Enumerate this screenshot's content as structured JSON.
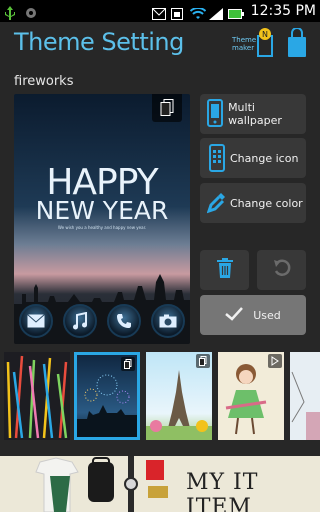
{
  "status_bar": {
    "time": "12:35 PM",
    "notification_badge": "N"
  },
  "header": {
    "title": "Theme Setting",
    "theme_maker_label": "Theme\nmaker",
    "accent_color": "#5cc0ea"
  },
  "theme_name": "fireworks",
  "preview": {
    "headline_1": "HAPPY",
    "headline_2": "NEW YEAR",
    "subline": "We wish you a healthy and happy new year.",
    "dock_icons": [
      "mail-icon",
      "music-icon",
      "phone-icon",
      "camera-icon"
    ]
  },
  "actions": {
    "multi_wallpaper": "Multi wallpaper",
    "change_icon": "Change icon",
    "change_color": "Change color",
    "used": "Used"
  },
  "thumbnails": [
    {
      "name": "lines",
      "selected": false
    },
    {
      "name": "fireworks",
      "selected": true
    },
    {
      "name": "paris",
      "selected": false
    },
    {
      "name": "girl",
      "selected": false
    },
    {
      "name": "partial",
      "selected": false
    }
  ],
  "ad": {
    "text": "MY IT ITEM"
  }
}
